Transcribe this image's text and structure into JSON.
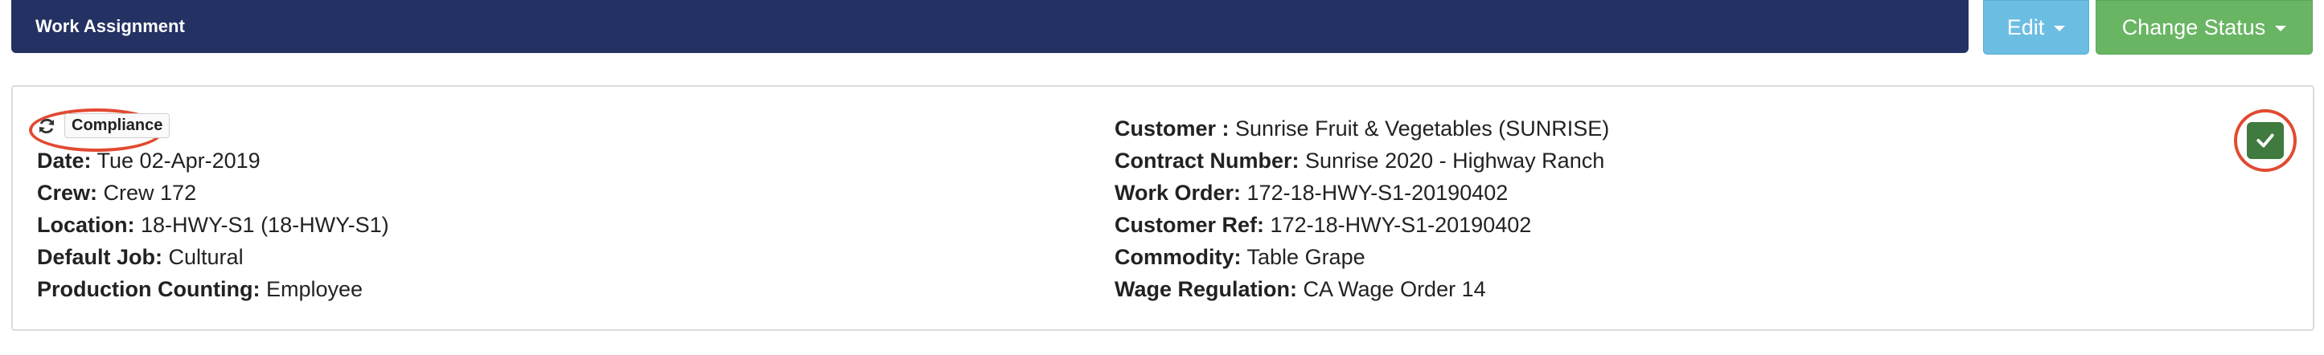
{
  "header": {
    "title": "Work Assignment"
  },
  "toolbar": {
    "edit_label": "Edit",
    "change_status_label": "Change Status"
  },
  "colors": {
    "header_bg": "#233262",
    "edit_bg": "#6cbde2",
    "status_bg": "#69b564",
    "highlight": "#e14a31",
    "check_bg": "#3f7a3f"
  },
  "card": {
    "badge": "Compliance",
    "refresh_icon": "refresh-icon",
    "check_icon": "check-icon",
    "left": [
      {
        "label": "Date:",
        "value": "Tue 02-Apr-2019"
      },
      {
        "label": "Crew:",
        "value": "Crew 172"
      },
      {
        "label": "Location:",
        "value": "18-HWY-S1 (18-HWY-S1)"
      },
      {
        "label": "Default Job:",
        "value": "Cultural"
      },
      {
        "label": "Production Counting:",
        "value": "Employee"
      }
    ],
    "right": [
      {
        "label": "Customer :",
        "value": "Sunrise Fruit & Vegetables (SUNRISE)"
      },
      {
        "label": "Contract Number:",
        "value": "Sunrise 2020 - Highway Ranch"
      },
      {
        "label": "Work Order:",
        "value": "172-18-HWY-S1-20190402"
      },
      {
        "label": "Customer Ref:",
        "value": "172-18-HWY-S1-20190402"
      },
      {
        "label": "Commodity:",
        "value": "Table Grape"
      },
      {
        "label": "Wage Regulation:",
        "value": "CA Wage Order 14"
      }
    ]
  }
}
